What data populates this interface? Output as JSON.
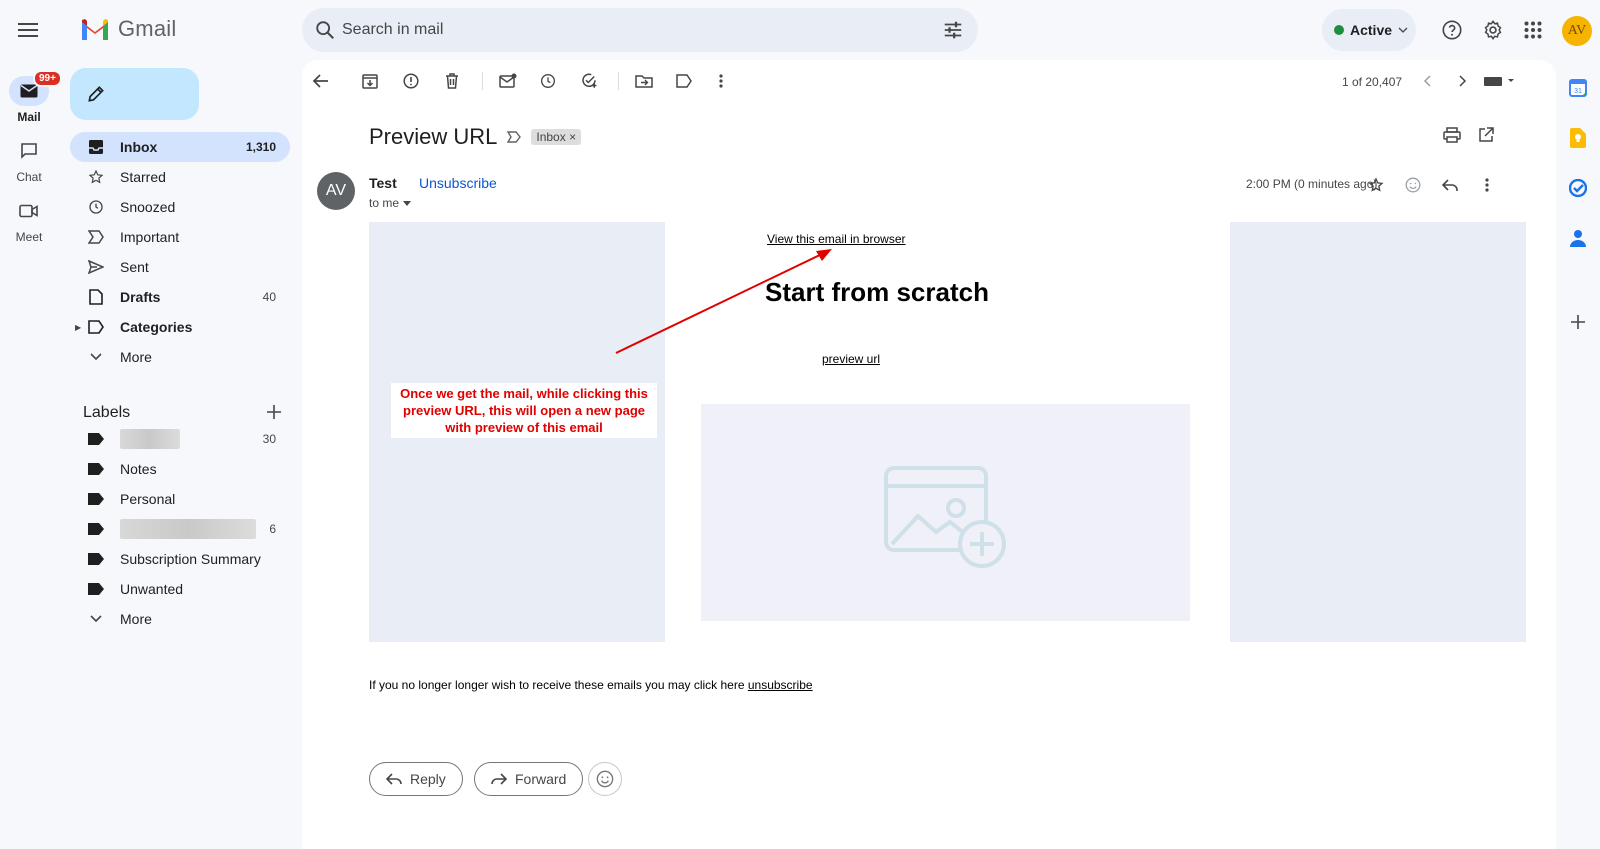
{
  "topbar": {
    "app_name": "Gmail",
    "search_placeholder": "Search in mail",
    "status": "Active",
    "avatar_initials": "AV"
  },
  "rail": {
    "mail": {
      "label": "Mail",
      "badge": "99+"
    },
    "chat": {
      "label": "Chat"
    },
    "meet": {
      "label": "Meet"
    }
  },
  "nav": {
    "items": [
      {
        "label": "Inbox",
        "count": "1,310",
        "icon": "inbox-icon"
      },
      {
        "label": "Starred",
        "count": "",
        "icon": "star-icon"
      },
      {
        "label": "Snoozed",
        "count": "",
        "icon": "clock-icon"
      },
      {
        "label": "Important",
        "count": "",
        "icon": "important-icon"
      },
      {
        "label": "Sent",
        "count": "",
        "icon": "send-icon"
      },
      {
        "label": "Drafts",
        "count": "40",
        "icon": "draft-icon"
      },
      {
        "label": "Categories",
        "count": "",
        "icon": "label-icon"
      },
      {
        "label": "More",
        "count": "",
        "icon": "chevron-down-icon"
      }
    ],
    "labels_title": "Labels",
    "labels": [
      {
        "label": "",
        "count": "30",
        "redacted": true
      },
      {
        "label": "Notes",
        "count": ""
      },
      {
        "label": "Personal",
        "count": ""
      },
      {
        "label": "",
        "count": "6",
        "redacted": true
      },
      {
        "label": "Subscription Summary",
        "count": ""
      },
      {
        "label": "Unwanted",
        "count": ""
      },
      {
        "label": "More",
        "count": ""
      }
    ]
  },
  "toolbar": {
    "pager": "1 of 20,407"
  },
  "message": {
    "subject": "Preview URL",
    "chip": "Inbox ×",
    "sender_initials": "AV",
    "sender": "Test",
    "unsubscribe": "Unsubscribe",
    "to": "to me",
    "time": "2:00 PM (0 minutes ago)",
    "body": {
      "view_in_browser": "View this email in browser",
      "heading": "Start from scratch",
      "preview_link": "preview url",
      "annotation": "Once we get the mail, while clicking this preview URL, this will open a new page with preview of this email",
      "footer_text": "If you no longer longer wish to receive these emails you may click here",
      "footer_link": "unsubscribe"
    },
    "reply": "Reply",
    "forward": "Forward"
  },
  "colors": {
    "accent": "#0b57d0",
    "selected": "#d3e3fd",
    "compose": "#c2e7ff",
    "annotation": "#e00000"
  }
}
